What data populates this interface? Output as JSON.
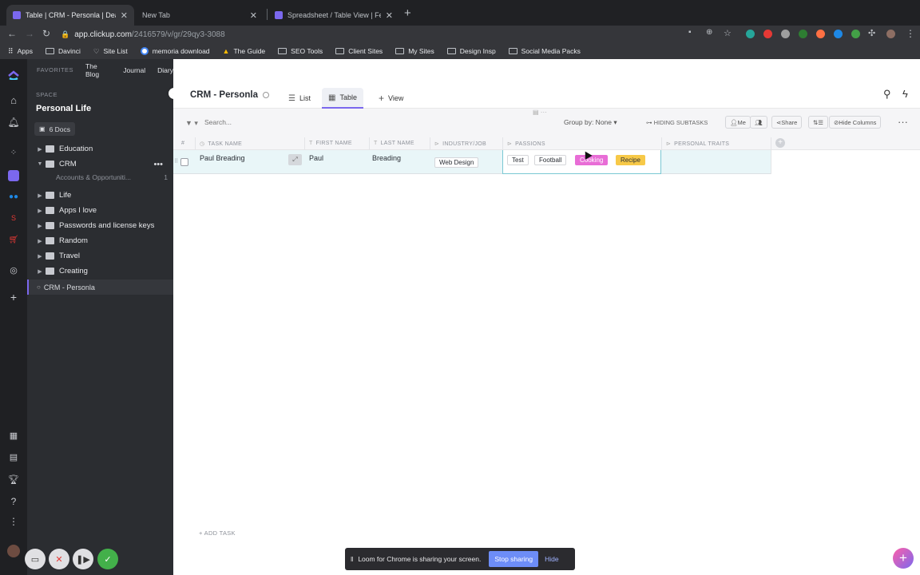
{
  "browser": {
    "tabs": [
      {
        "label": "Table | CRM - Personla | Dean",
        "color": "#7b68ee"
      },
      {
        "label": "New Tab",
        "color": ""
      },
      {
        "label": "Spreadsheet / Table View | Fea",
        "color": "#7b68ee"
      }
    ],
    "url_host": "app.clickup.com",
    "url_path": "/2416579/v/gr/29qy3-3088",
    "bookmarks": [
      {
        "label": "Apps",
        "icon": "apps-grid-icon"
      },
      {
        "label": "Davinci",
        "icon": "folder-icon"
      },
      {
        "label": "Site List",
        "icon": "heart-icon"
      },
      {
        "label": "memoria download",
        "icon": "google-icon"
      },
      {
        "label": "The Guide",
        "icon": "drive-icon"
      },
      {
        "label": "SEO Tools",
        "icon": "folder-icon"
      },
      {
        "label": "Client Sites",
        "icon": "folder-icon"
      },
      {
        "label": "My Sites",
        "icon": "folder-icon"
      },
      {
        "label": "Design Insp",
        "icon": "folder-icon"
      },
      {
        "label": "Social Media Packs",
        "icon": "folder-icon"
      }
    ]
  },
  "sidebar": {
    "favorites_label": "FAVORITES",
    "favorites": [
      "The Blog",
      "Journal",
      "Diary"
    ],
    "space_label": "SPACE",
    "space_name": "Personal Life",
    "docs_button": "6 Docs",
    "folders": [
      {
        "label": "Education",
        "expanded": false
      },
      {
        "label": "CRM",
        "expanded": true
      },
      {
        "label": "Life",
        "expanded": false
      },
      {
        "label": "Apps I love",
        "expanded": false
      },
      {
        "label": "Passwords and license keys",
        "expanded": false
      },
      {
        "label": "Random",
        "expanded": false
      },
      {
        "label": "Travel",
        "expanded": false
      },
      {
        "label": "Creating",
        "expanded": false
      }
    ],
    "crm_sublist": {
      "label": "Accounts & Opportuniti...",
      "count": "1"
    },
    "active_list": "CRM - Personla"
  },
  "header": {
    "title": "CRM - Personla",
    "views": [
      "List",
      "Table",
      "View"
    ],
    "active_view": "Table"
  },
  "filterbar": {
    "search_placeholder": "Search...",
    "group_by": "Group by: None",
    "hiding_subtasks": "HIDING SUBTASKS",
    "me": "Me",
    "share": "Share",
    "hide_columns": "Hide Columns"
  },
  "table": {
    "columns": [
      "#",
      "TASK NAME",
      "FIRST NAME",
      "LAST NAME",
      "INDUSTRY/JOB",
      "PASSIONS",
      "PERSONAL TRAITS"
    ],
    "rows": [
      {
        "task_name": "Paul Breading",
        "first_name": "Paul",
        "last_name": "Breading",
        "industry": "Web Design",
        "passions": [
          {
            "label": "Test",
            "bg": "#ffffff",
            "fg": "#292d34"
          },
          {
            "label": "Football",
            "bg": "#ffffff",
            "fg": "#292d34"
          },
          {
            "label": "Cooking",
            "bg": "#e86dd6",
            "fg": "#ffffff"
          },
          {
            "label": "Recipe",
            "bg": "#f7c948",
            "fg": "#292d34"
          }
        ],
        "personal_traits": ""
      }
    ],
    "add_task": "+ ADD TASK"
  },
  "loom": {
    "message": "Loom for Chrome is sharing your screen.",
    "stop": "Stop sharing",
    "hide": "Hide"
  },
  "colors": {
    "accent": "#7b68ee",
    "row_highlight": "#e9f6f8"
  }
}
